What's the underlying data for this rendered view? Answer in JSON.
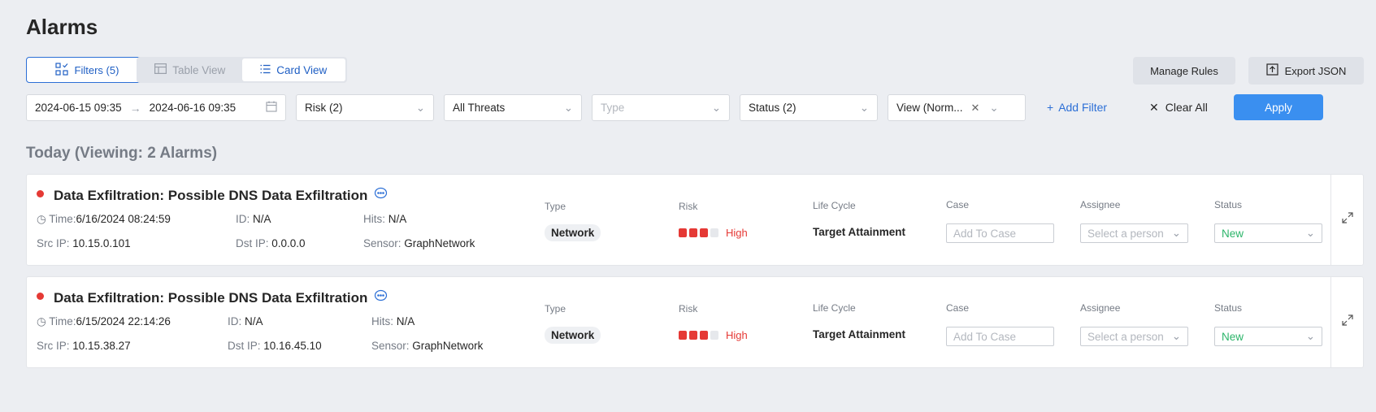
{
  "page": {
    "title": "Alarms"
  },
  "toolbar": {
    "filters_label": "Filters (5)",
    "table_view_label": "Table View",
    "card_view_label": "Card View",
    "manage_rules_label": "Manage Rules",
    "export_json_label": "Export JSON"
  },
  "filters": {
    "date_start": "2024-06-15 09:35",
    "date_end": "2024-06-16 09:35",
    "risk": "Risk  (2)",
    "threats": "All Threats",
    "type_placeholder": "Type",
    "status": "Status  (2)",
    "view": "View (Norm...",
    "add_filter_label": "Add Filter",
    "clear_all_label": "Clear All",
    "apply_label": "Apply"
  },
  "section": {
    "title": "Today (Viewing: 2 Alarms)"
  },
  "labels": {
    "time": "Time:",
    "id": "ID:",
    "hits": "Hits:",
    "src_ip": "Src IP:",
    "dst_ip": "Dst IP:",
    "sensor": "Sensor:",
    "col_type": "Type",
    "col_risk": "Risk",
    "col_lifecycle": "Life Cycle",
    "col_case": "Case",
    "col_assignee": "Assignee",
    "col_status": "Status",
    "case_placeholder": "Add To Case",
    "assignee_placeholder": "Select a person"
  },
  "alarms": [
    {
      "title": "Data Exfiltration: Possible DNS Data Exfiltration",
      "time": "6/16/2024 08:24:59",
      "id": "N/A",
      "hits": "N/A",
      "src_ip": "10.15.0.101",
      "dst_ip": "0.0.0.0",
      "sensor": "GraphNetwork",
      "type": "Network",
      "risk_label": "High",
      "risk_level": 3,
      "risk_max": 4,
      "lifecycle": "Target Attainment",
      "status": "New"
    },
    {
      "title": "Data Exfiltration: Possible DNS Data Exfiltration",
      "time": "6/15/2024 22:14:26",
      "id": "N/A",
      "hits": "N/A",
      "src_ip": "10.15.38.27",
      "dst_ip": "10.16.45.10",
      "sensor": "GraphNetwork",
      "type": "Network",
      "risk_label": "High",
      "risk_level": 3,
      "risk_max": 4,
      "lifecycle": "Target Attainment",
      "status": "New"
    }
  ],
  "colors": {
    "accent": "#2c6fd6",
    "apply": "#3a8ff0",
    "risk_high": "#e53935",
    "status_new": "#2cb56a"
  }
}
